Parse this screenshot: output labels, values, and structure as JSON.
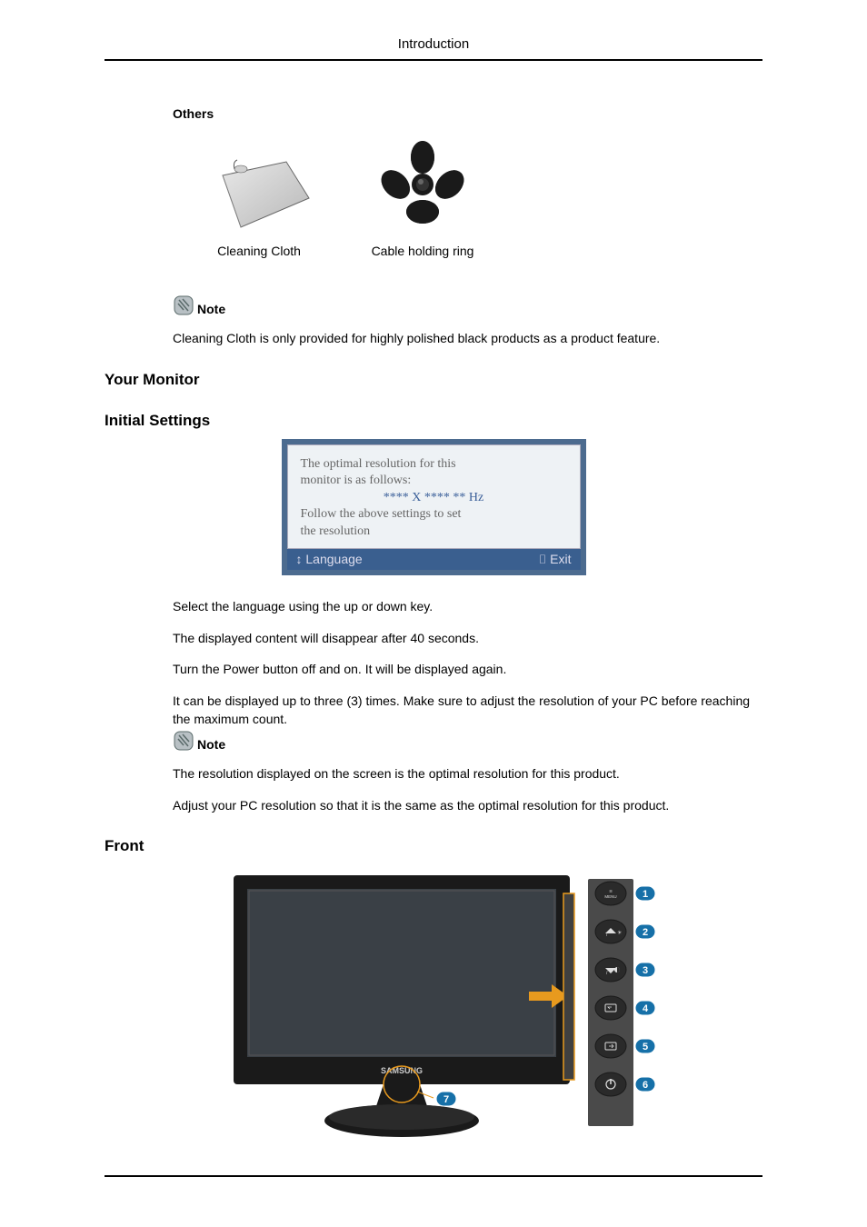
{
  "header": {
    "title": "Introduction"
  },
  "others": {
    "label": "Others",
    "cloth_caption": "Cleaning Cloth",
    "ring_caption": "Cable holding ring"
  },
  "note1": {
    "label": "Note",
    "text": "Cleaning Cloth is only provided for highly polished black products as a product feature."
  },
  "sections": {
    "your_monitor": "Your Monitor",
    "initial_settings": "Initial Settings",
    "front": "Front"
  },
  "osd": {
    "line1": "The optimal resolution for this",
    "line2": "monitor is as follows:",
    "hz": "**** X **** ** Hz",
    "line3": "Follow the above settings to set",
    "line4": "the resolution",
    "footer_left": "↕ Language",
    "footer_right": "⌷ Exit"
  },
  "settings_text": {
    "p1": "Select the language using the up or down key.",
    "p2": "The displayed content will disappear after 40 seconds.",
    "p3": "Turn the Power button off and on. It will be displayed again.",
    "p4": "It can be displayed up to three (3) times. Make sure to adjust the resolution of your PC before reaching the maximum count."
  },
  "note2": {
    "label": "Note",
    "p1": "The resolution displayed on the screen is the optimal resolution for this product.",
    "p2": "Adjust your PC resolution so that it is the same as the optimal resolution for this product."
  },
  "front": {
    "brand": "SAMSUNG",
    "callout_7": "7",
    "buttons": [
      {
        "n": "1",
        "icon": "menu"
      },
      {
        "n": "2",
        "icon": "up-bright"
      },
      {
        "n": "3",
        "icon": "down-contrast"
      },
      {
        "n": "4",
        "icon": "enter"
      },
      {
        "n": "5",
        "icon": "source"
      },
      {
        "n": "6",
        "icon": "power"
      }
    ]
  }
}
